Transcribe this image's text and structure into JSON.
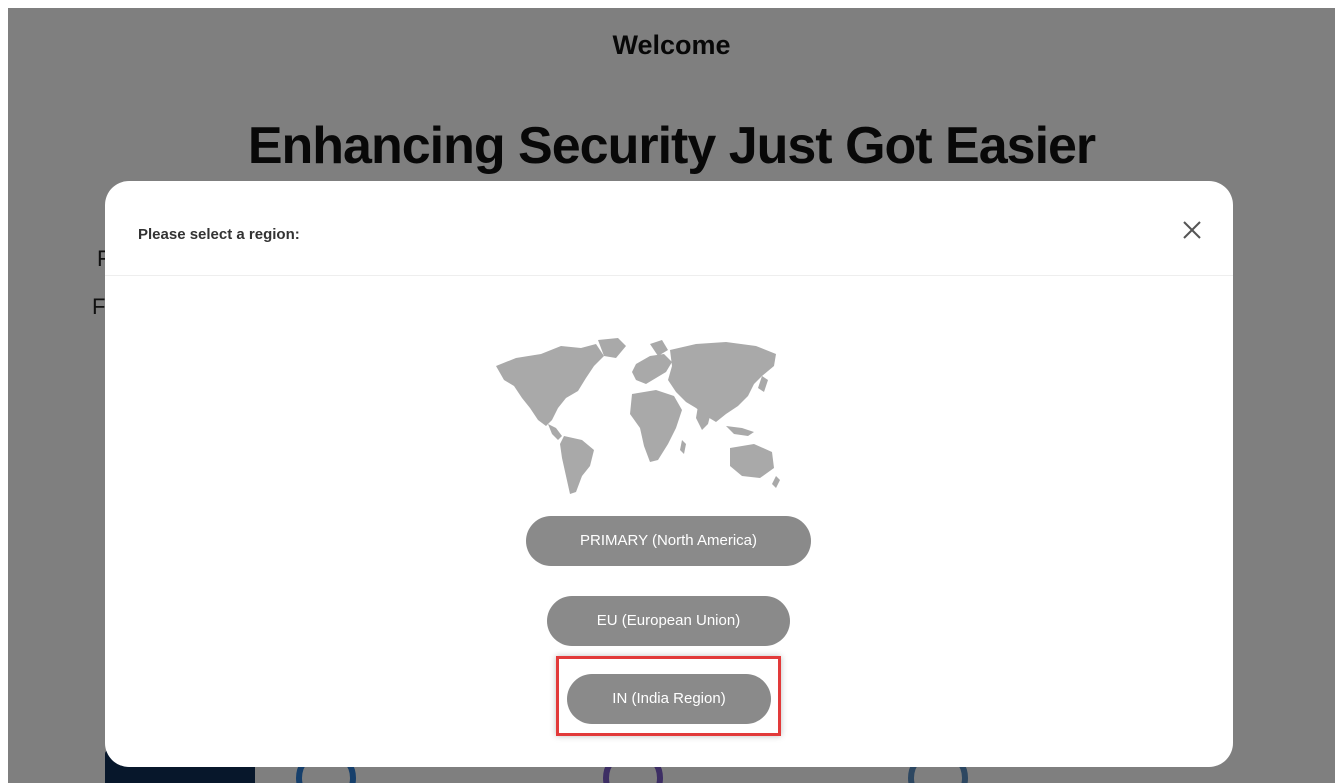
{
  "background": {
    "welcome": "Welcome",
    "headline": "Enhancing Security Just Got Easier",
    "fragment_1": "F",
    "fragment_2": "F"
  },
  "modal": {
    "title": "Please select a region:",
    "close_icon": "close-icon",
    "map_icon": "world-map-icon",
    "regions": [
      {
        "label": "PRIMARY (North America)"
      },
      {
        "label": "EU (European Union)"
      },
      {
        "label": "IN (India Region)"
      }
    ]
  },
  "colors": {
    "overlay": "rgba(0,0,0,0.5)",
    "button": "#8a8a8a",
    "highlight": "#e23a3a"
  }
}
